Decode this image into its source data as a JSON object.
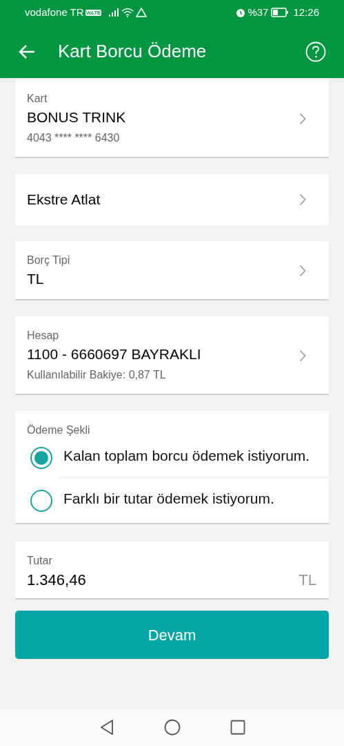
{
  "status_bar": {
    "carrier": "vodafone TR",
    "network_badge": "VoLTE",
    "battery": "%37",
    "time": "12:26"
  },
  "header": {
    "title": "Kart Borcu Ödeme"
  },
  "fields": [
    {
      "kind": "select",
      "label": "Kart",
      "value": "BONUS TRINK",
      "detail": "4043 **** **** 6430"
    },
    {
      "kind": "link",
      "value": "Ekstre Atlat"
    },
    {
      "kind": "select",
      "label": "Borç Tipi",
      "value": "TL"
    },
    {
      "kind": "select",
      "label": "Hesap",
      "value": "1100 - 6660697 BAYRAKLI",
      "detail": "Kullanılabilir Bakiye: 0,87 TL"
    }
  ],
  "payment": {
    "label": "Ödeme Şekli",
    "options": [
      {
        "label": "Kalan toplam borcu ödemek istiyorum.",
        "selected": true
      },
      {
        "label": "Farklı bir tutar ödemek istiyorum.",
        "selected": false
      }
    ]
  },
  "amount": {
    "label": "Tutar",
    "value": "1.346,46",
    "currency": "TL"
  },
  "button": {
    "label": "Devam"
  }
}
